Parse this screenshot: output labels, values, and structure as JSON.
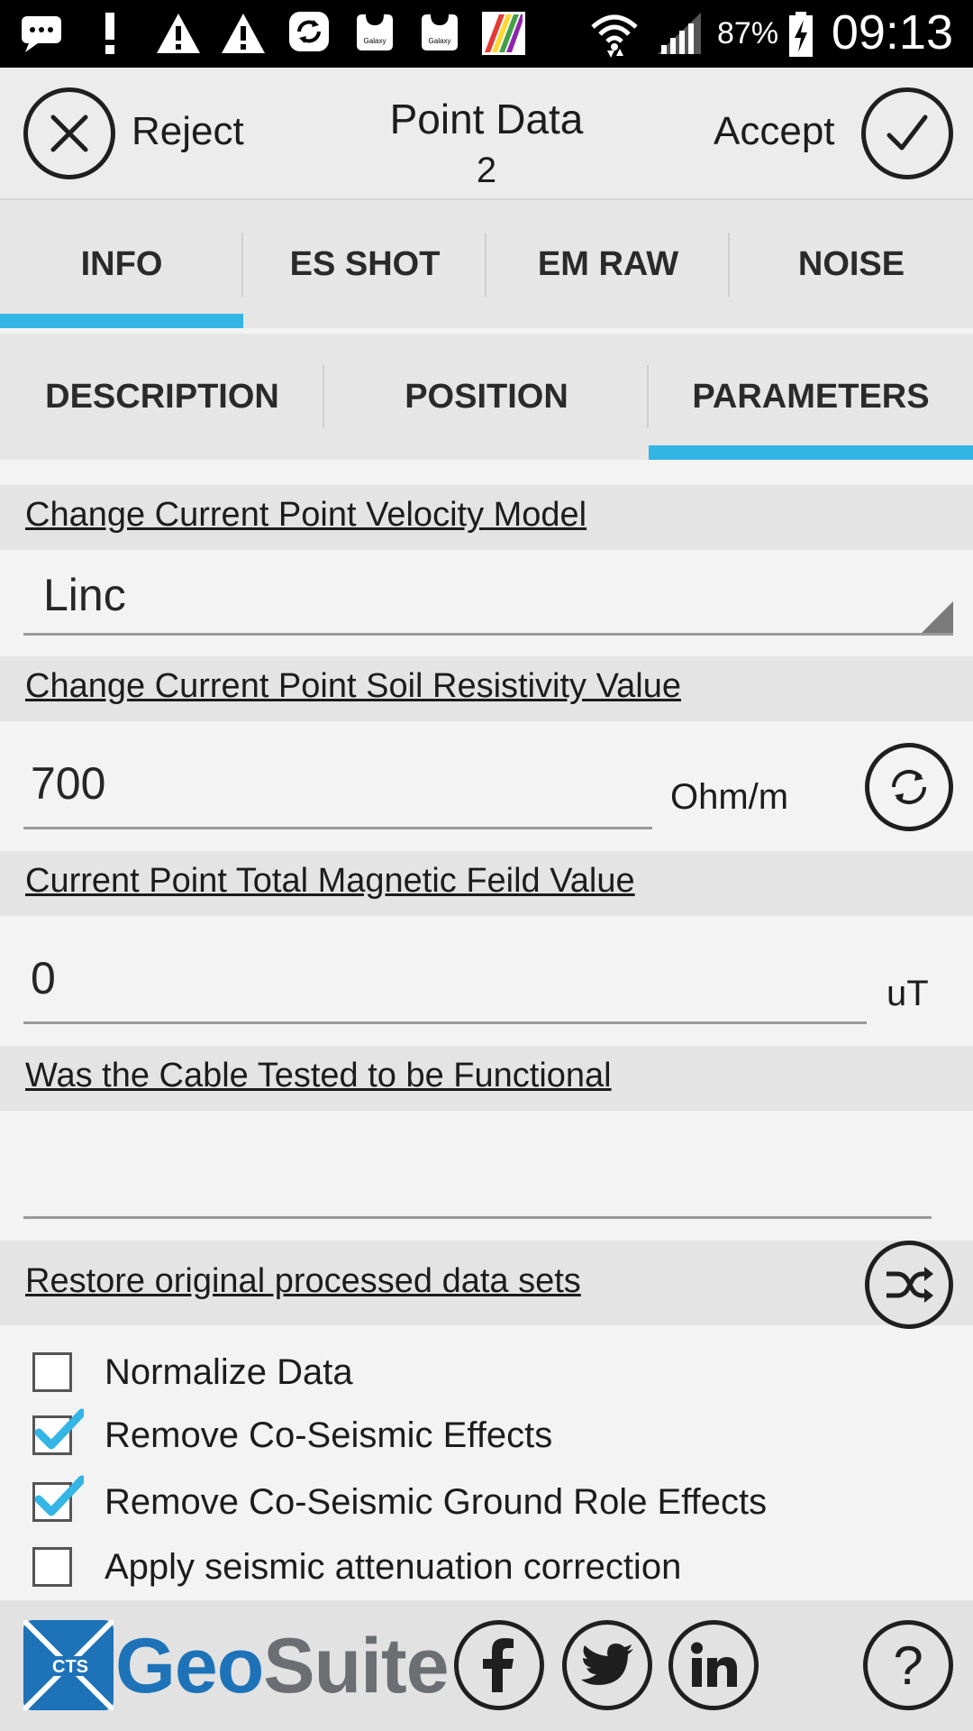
{
  "status_bar": {
    "battery": "87%",
    "clock": "09:13",
    "icons": [
      "message-icon",
      "alert-icon",
      "warning-icon",
      "warning-icon",
      "sync-icon",
      "galaxy-icon",
      "galaxy-icon",
      "gallery-icon",
      "wifi-icon",
      "signal-icon",
      "battery-charging-icon"
    ],
    "galaxy_label": "Galaxy"
  },
  "header": {
    "reject_label": "Reject",
    "accept_label": "Accept",
    "title": "Point Data",
    "subtitle": "2"
  },
  "tabs_primary": [
    "INFO",
    "ES SHOT",
    "EM RAW",
    "NOISE"
  ],
  "tabs_primary_active": 0,
  "tabs_secondary": [
    "DESCRIPTION",
    "POSITION",
    "PARAMETERS"
  ],
  "tabs_secondary_active": 2,
  "velocity": {
    "label": "Change Current Point Velocity Model",
    "value": "Linc"
  },
  "soil": {
    "label": "Change Current Point Soil Resistivity Value",
    "value": "700",
    "unit": "Ohm/m"
  },
  "magnetic": {
    "label": "Current Point Total Magnetic Feild Value",
    "value": "0",
    "unit": "uT"
  },
  "cable": {
    "label": "Was the Cable Tested to be Functional",
    "value": ""
  },
  "restore": {
    "label": "Restore original processed data sets"
  },
  "options": [
    {
      "label": "Normalize Data",
      "checked": false
    },
    {
      "label": "Remove Co-Seismic Effects",
      "checked": true
    },
    {
      "label": "Remove Co-Seismic Ground Role Effects",
      "checked": true
    },
    {
      "label": "Apply seismic attenuation correction",
      "checked": false
    }
  ],
  "footer": {
    "brand": "GeoSuite",
    "logo_text": "CTS",
    "help": "?"
  },
  "colors": {
    "accent": "#33b5e5",
    "brand_blue": "#1e73b8",
    "brand_gray": "#6b6e72"
  }
}
